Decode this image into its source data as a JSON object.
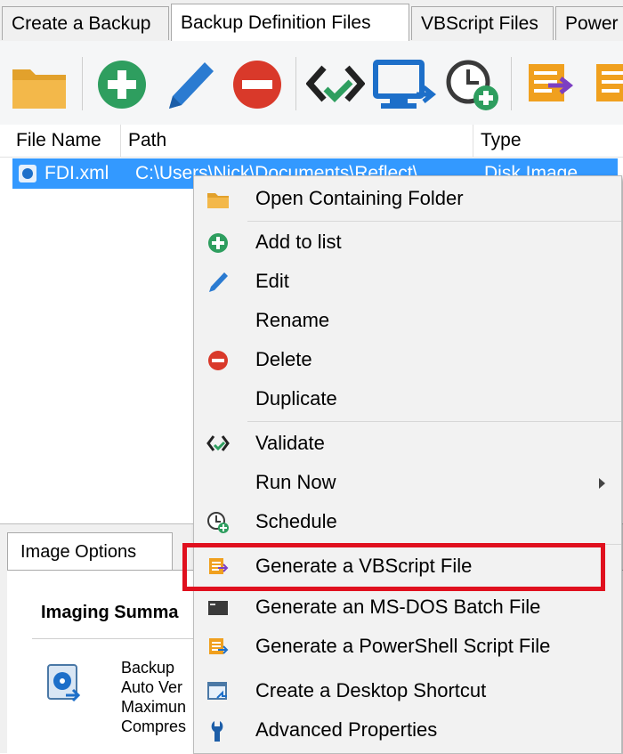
{
  "tabs": [
    "Create a Backup",
    "Backup Definition Files",
    "VBScript Files",
    "Power"
  ],
  "toolbar": {
    "icons": [
      "folder-icon",
      "add-icon",
      "edit-icon",
      "delete-icon",
      "validate-icon",
      "run-icon",
      "schedule-icon",
      "vbscript-icon",
      "powershell-icon"
    ]
  },
  "columns": [
    "File Name",
    "Path",
    "Type"
  ],
  "row": {
    "name": "FDI.xml",
    "path": "C:\\Users\\Nick\\Documents\\Reflect\\",
    "type": "Disk Image"
  },
  "lower": {
    "tab": "Image Options",
    "summary_title": "Imaging Summa",
    "lines": [
      "Backup",
      "Auto Ver",
      "Maximun",
      "Compres"
    ]
  },
  "menu": {
    "items": [
      {
        "label": "Open Containing Folder",
        "icon": "folder-icon"
      },
      {
        "label": "Add to list",
        "icon": "add-icon"
      },
      {
        "label": "Edit",
        "icon": "edit-icon"
      },
      {
        "label": "Rename",
        "icon": ""
      },
      {
        "label": "Delete",
        "icon": "delete-icon"
      },
      {
        "label": "Duplicate",
        "icon": ""
      },
      {
        "label": "Validate",
        "icon": "validate-icon"
      },
      {
        "label": "Run Now",
        "icon": ""
      },
      {
        "label": "Schedule",
        "icon": "schedule-icon"
      },
      {
        "label": "Generate a VBScript File",
        "icon": "vbscript-icon"
      },
      {
        "label": "Generate an MS-DOS Batch File",
        "icon": "batch-icon"
      },
      {
        "label": "Generate a PowerShell Script File",
        "icon": "powershell-icon"
      },
      {
        "label": "Create a Desktop Shortcut",
        "icon": "shortcut-icon"
      },
      {
        "label": "Advanced Properties",
        "icon": "wrench-icon"
      }
    ]
  },
  "colors": {
    "selection": "#3399ff",
    "highlight_box": "#e0101e",
    "accent_green": "#2e9e5f",
    "accent_red": "#d9392a",
    "accent_blue": "#2b7bd1",
    "accent_orange": "#f0a01e"
  }
}
